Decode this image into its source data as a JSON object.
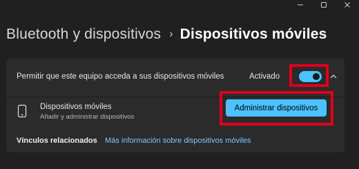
{
  "window_controls": {
    "minimize_icon": "minimize-icon",
    "maximize_icon": "maximize-icon",
    "close_icon": "close-icon"
  },
  "breadcrumb": {
    "parent": "Bluetooth y dispositivos",
    "separator": "›",
    "current": "Dispositivos móviles"
  },
  "setting": {
    "label": "Permitir que este equipo acceda a sus dispositivos móviles",
    "status": "Activado",
    "toggle_on": true,
    "accent_color": "#4cc2ff",
    "highlight_color": "#e0001a"
  },
  "device_row": {
    "icon": "phone-icon",
    "title": "Dispositivos móviles",
    "subtitle": "Añadir y administrar dispositivos",
    "button_label": "Administrar dispositivos"
  },
  "related": {
    "label": "Vínculos relacionados",
    "link_text": "Más información sobre dispositivos móviles"
  }
}
